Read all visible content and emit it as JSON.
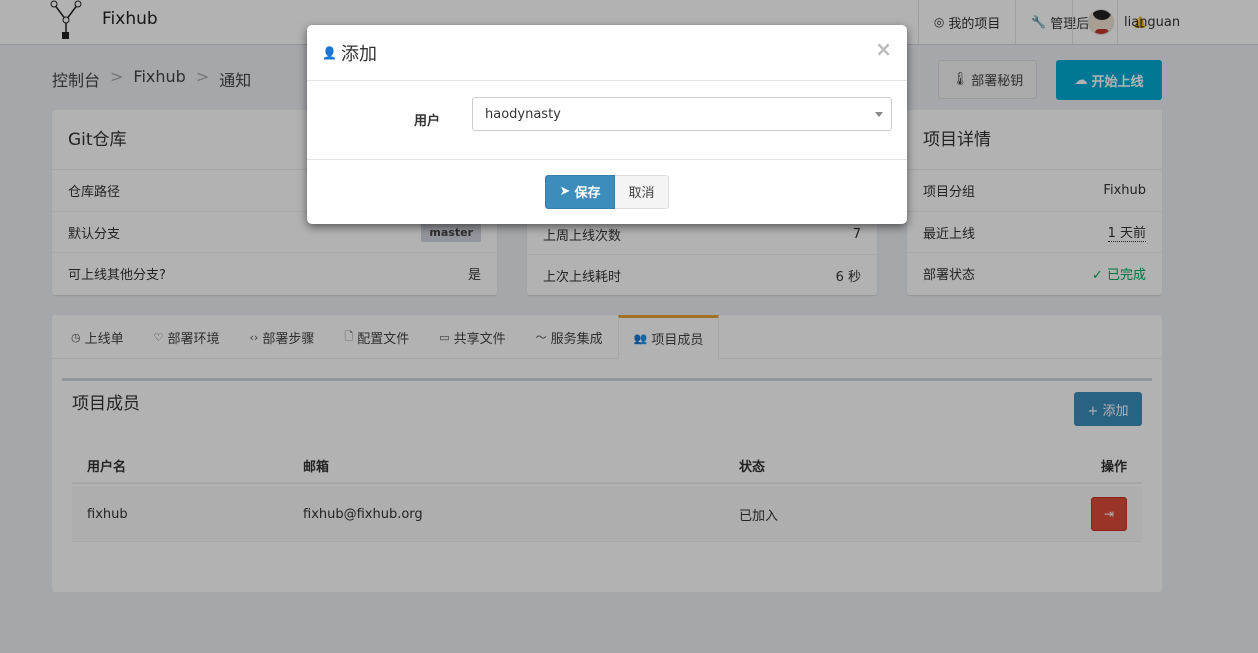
{
  "header": {
    "brand": "Fixhub",
    "nav": [
      {
        "icon": "target-icon",
        "glyph": "◎",
        "label": "我的项目"
      },
      {
        "icon": "wrench-icon",
        "glyph": "🔧",
        "label": "管理后台"
      }
    ],
    "bell_glyph": "🔔",
    "username": "lianguan"
  },
  "breadcrumb": {
    "items": [
      "控制台",
      "Fixhub",
      "通知"
    ],
    "separator": ">"
  },
  "actions": {
    "keys_label": "部署秘钥",
    "deploy_label": "开始上线"
  },
  "git_box": {
    "title": "Git仓库",
    "rows": [
      {
        "key": "仓库路径",
        "value": ""
      },
      {
        "key": "默认分支",
        "value": "master"
      },
      {
        "key": "可上线其他分支?",
        "value": "是"
      }
    ]
  },
  "stats_box": {
    "rows": [
      {
        "key": "上周上线次数",
        "value": "7"
      },
      {
        "key": "上次上线耗时",
        "value": "6 秒"
      }
    ]
  },
  "detail_box": {
    "title": "项目详情",
    "rows": [
      {
        "key": "项目分组",
        "value": "Fixhub"
      },
      {
        "key": "最近上线",
        "value": "1 天前"
      },
      {
        "key": "部署状态",
        "value": "✓ 已完成"
      }
    ],
    "success_color": "#00a65a"
  },
  "tabs": [
    {
      "icon": "clock-icon",
      "glyph": "◷",
      "label": "上线单"
    },
    {
      "icon": "heart-icon",
      "glyph": "♡",
      "label": "部署环境"
    },
    {
      "icon": "code-icon",
      "glyph": "‹›",
      "label": "部署步骤"
    },
    {
      "icon": "file-icon",
      "glyph": "🗋",
      "label": "配置文件"
    },
    {
      "icon": "folder-icon",
      "glyph": "▭",
      "label": "共享文件"
    },
    {
      "icon": "link-icon",
      "glyph": "〜",
      "label": "服务集成"
    },
    {
      "icon": "users-icon",
      "glyph": "👥",
      "label": "项目成员"
    }
  ],
  "members": {
    "title": "项目成员",
    "add_label": "+ 添加",
    "columns": [
      "用户名",
      "邮箱",
      "状态",
      "操作"
    ],
    "rows": [
      {
        "username": "fixhub",
        "email": "fixhub@fixhub.org",
        "status": "已加入"
      }
    ]
  },
  "modal": {
    "title": "添加",
    "field_label": "用户",
    "selected_user": "haodynasty",
    "save_label": "保存",
    "cancel_label": "取消",
    "close_glyph": "×"
  },
  "colors": {
    "primary": "#3c8dbc",
    "info": "#00acd6",
    "danger": "#dd4b39"
  }
}
